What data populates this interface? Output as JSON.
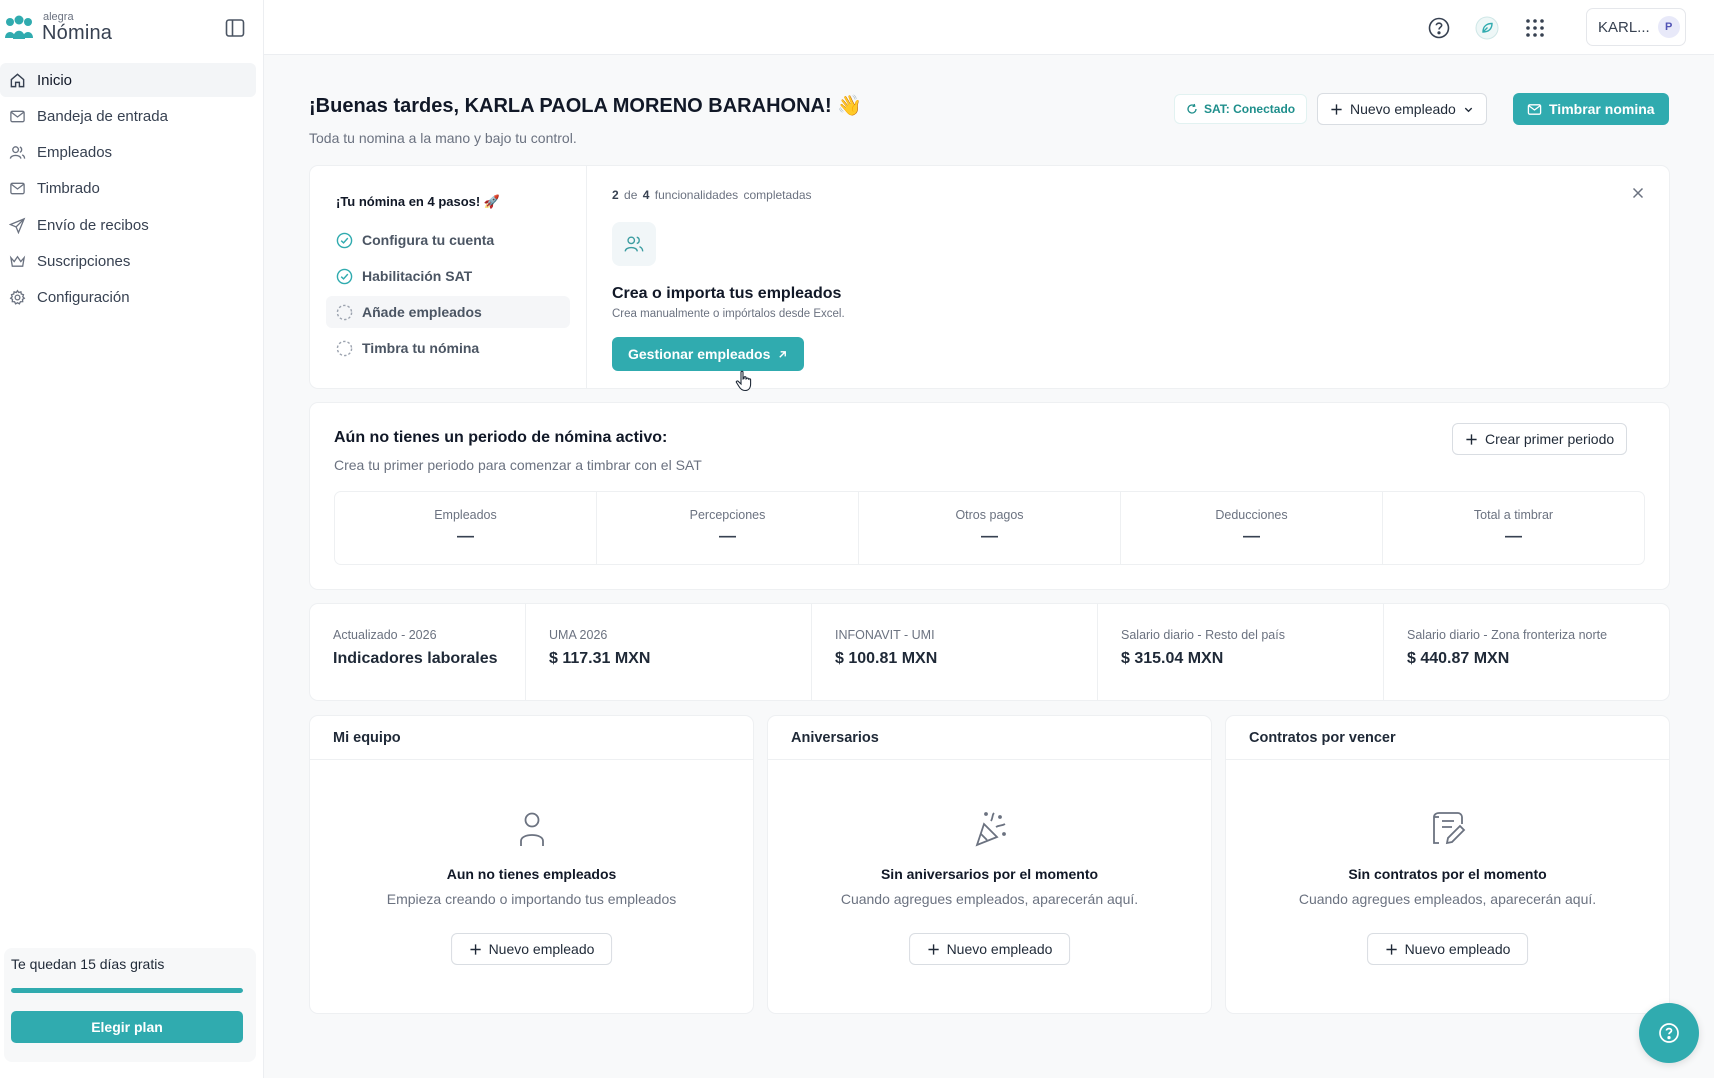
{
  "app": {
    "logo_small": "alegra",
    "logo_big": "Nómina"
  },
  "sidebar": {
    "items": [
      {
        "label": "Inicio",
        "icon": "home-icon",
        "active": true
      },
      {
        "label": "Bandeja de entrada",
        "icon": "inbox-icon"
      },
      {
        "label": "Empleados",
        "icon": "users-icon"
      },
      {
        "label": "Timbrado",
        "icon": "mail-icon"
      },
      {
        "label": "Envío de recibos",
        "icon": "send-icon"
      },
      {
        "label": "Suscripciones",
        "icon": "crown-icon"
      },
      {
        "label": "Configuración",
        "icon": "gear-icon"
      }
    ],
    "trial": {
      "text": "Te quedan 15 días gratis",
      "progress": 1.0,
      "button": "Elegir plan"
    }
  },
  "topbar": {
    "user_name": "KARL...",
    "avatar_initial": "P"
  },
  "header": {
    "greeting": "¡Buenas tardes, KARLA PAOLA MORENO BARAHONA! 👋",
    "subtitle": "Toda tu nomina a la mano y bajo tu control.",
    "sat_status": "SAT: Conectado",
    "new_employee_label": "Nuevo empleado",
    "stamp_label": "Timbrar nomina"
  },
  "onboarding": {
    "title": "¡Tu nómina en 4 pasos! 🚀",
    "steps": [
      {
        "label": "Configura tu cuenta",
        "done": true
      },
      {
        "label": "Habilitación SAT",
        "done": true
      },
      {
        "label": "Añade empleados",
        "done": false
      },
      {
        "label": "Timbra tu nómina",
        "done": false
      }
    ],
    "progress_done": "2",
    "progress_of": "de",
    "progress_total": "4",
    "progress_suffix": "funcionalidades completadas",
    "feature_title": "Crea o importa tus empleados",
    "feature_desc": "Crea manualmente o impórtalos desde Excel.",
    "feature_button": "Gestionar empleados"
  },
  "period": {
    "title": "Aún no tienes un periodo de nómina activo:",
    "desc": "Crea tu primer periodo para comenzar a timbrar con el SAT",
    "create_label": "Crear primer periodo",
    "stats": [
      {
        "label": "Empleados",
        "value": "—"
      },
      {
        "label": "Percepciones",
        "value": "—"
      },
      {
        "label": "Otros pagos",
        "value": "—"
      },
      {
        "label": "Deducciones",
        "value": "—"
      },
      {
        "label": "Total a timbrar",
        "value": "—"
      }
    ]
  },
  "indicators": {
    "updated": "Actualizado - 2026",
    "title": "Indicadores laborales",
    "items": [
      {
        "label": "UMA 2026",
        "value": "$ 117.31 MXN"
      },
      {
        "label": "INFONAVIT - UMI",
        "value": "$ 100.81 MXN"
      },
      {
        "label": "Salario diario - Resto del país",
        "value": "$ 315.04 MXN"
      },
      {
        "label": "Salario diario - Zona fronteriza norte",
        "value": "$ 440.87 MXN"
      }
    ]
  },
  "panels": [
    {
      "title": "Mi equipo",
      "icon": "person-icon",
      "empty_title": "Aun no tienes empleados",
      "empty_desc": "Empieza creando o importando tus empleados",
      "button": "Nuevo empleado"
    },
    {
      "title": "Aniversarios",
      "icon": "party-popper-icon",
      "empty_title": "Sin aniversarios por el momento",
      "empty_desc": "Cuando agregues empleados, aparecerán aquí.",
      "button": "Nuevo empleado"
    },
    {
      "title": "Contratos por vencer",
      "icon": "contract-icon",
      "empty_title": "Sin contratos por el momento",
      "empty_desc": "Cuando agregues empleados, aparecerán aquí.",
      "button": "Nuevo empleado"
    }
  ],
  "colors": {
    "accent": "#30abaf",
    "sat_text": "#1f8f8c"
  }
}
